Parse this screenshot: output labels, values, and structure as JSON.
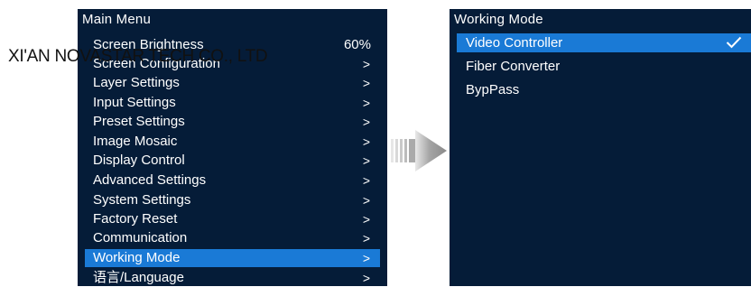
{
  "main_menu": {
    "title": "Main Menu",
    "items": [
      {
        "label": "Screen Brightness",
        "value": "60%"
      },
      {
        "label": "Screen Configuration",
        "arrow": ">"
      },
      {
        "label": "Layer Settings",
        "arrow": ">"
      },
      {
        "label": "Input Settings",
        "arrow": ">"
      },
      {
        "label": "Preset Settings",
        "arrow": ">"
      },
      {
        "label": "Image Mosaic",
        "arrow": ">"
      },
      {
        "label": "Display Control",
        "arrow": ">"
      },
      {
        "label": "Advanced Settings",
        "arrow": ">"
      },
      {
        "label": "System Settings",
        "arrow": ">"
      },
      {
        "label": "Factory Reset",
        "arrow": ">"
      },
      {
        "label": "Communication",
        "arrow": ">"
      },
      {
        "label": "Working Mode",
        "arrow": ">"
      },
      {
        "label": "语言/Language",
        "arrow": ">"
      }
    ],
    "selected": "Working Mode"
  },
  "working_mode": {
    "title": "Working Mode",
    "options": [
      {
        "label": "Video Controller",
        "selected": true
      },
      {
        "label": "Fiber Converter",
        "selected": false
      },
      {
        "label": "BypPass",
        "selected": false
      }
    ],
    "check_icon": "check-icon"
  },
  "watermark": "XI'AN NOVASTAR TECH CO., LTD",
  "transition_icon": "right-arrow-icon",
  "colors": {
    "panel_bg": "#051c38",
    "highlight": "#1a7ad6",
    "text": "#ffffff",
    "arrow_gray": "#8a8a8a"
  }
}
